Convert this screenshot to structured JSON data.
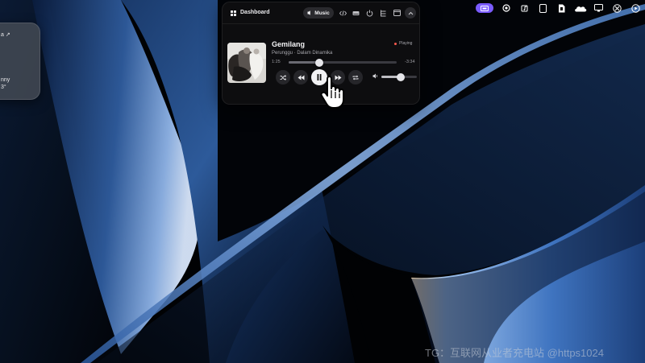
{
  "left_widget": {
    "top_text": "a ↗",
    "mid_text": "nny",
    "bot_text": "3°"
  },
  "menubar": {
    "icons": [
      "app-pill-icon",
      "record-icon",
      "music-note-icon",
      "card-icon",
      "battery-icon",
      "cloud-icon",
      "display-icon",
      "vpn-icon",
      "play-icon",
      "clock-icon"
    ]
  },
  "dashboard": {
    "title": "Dashboard",
    "active_tab": "Music",
    "tabs": [
      "code-icon",
      "drive-icon",
      "power-icon",
      "list-tree-icon",
      "calendar-icon",
      "collapse-icon"
    ]
  },
  "player": {
    "title": "Gemilang",
    "artist": "Perunggu · Dalam Dinamika",
    "status": "Playing",
    "elapsed": "1:25",
    "remaining": "-3:34",
    "progress": 0.28,
    "volume": 0.55
  },
  "colors": {
    "accent": "#7b5cff",
    "playing_dot": "#ff5a4e",
    "panel_bg": "#0e0e10"
  },
  "watermark": "TG：互联网从业者充电站 @https1024"
}
